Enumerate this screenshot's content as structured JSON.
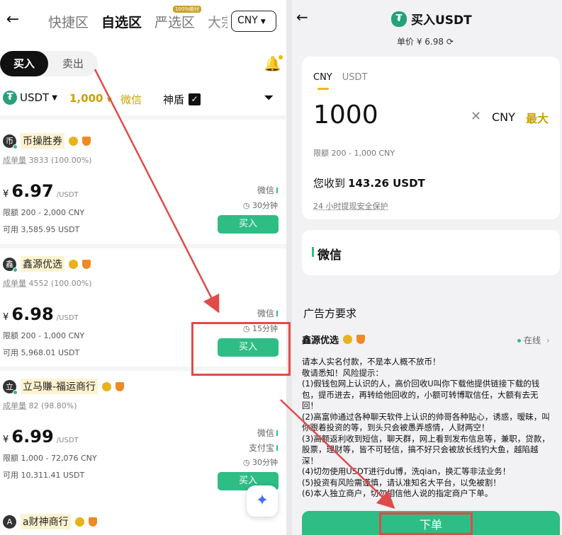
{
  "left": {
    "back_icon": "arrow-left-icon",
    "zone_tabs": [
      {
        "label": "快捷区",
        "active": false
      },
      {
        "label": "自选区",
        "active": true
      },
      {
        "label": "严选区",
        "active": false,
        "badge": "100%赔付"
      },
      {
        "label": "大宗",
        "active": false
      }
    ],
    "currency": "CNY",
    "buy_label": "买入",
    "sell_label": "卖出",
    "filters": {
      "asset": "USDT",
      "amount": "1,000",
      "payment": "微信",
      "shendun": "神盾",
      "shendun_checked": "✓"
    },
    "merchants": [
      {
        "avatar": "币",
        "name": "币操胜券",
        "trades_label": "成单量",
        "trades": "3833 (100.00%)",
        "currency_symbol": "¥",
        "price": "6.97",
        "unit": "/USDT",
        "limit_label": "限额",
        "limit": "200 - 2,000 CNY",
        "avail_label": "可用",
        "available": "3,585.95 USDT",
        "payments": [
          "微信"
        ],
        "time": "30分钟",
        "buy_label": "买入"
      },
      {
        "avatar": "鑫",
        "name": "鑫源优选",
        "trades_label": "成单量",
        "trades": "4552 (100.00%)",
        "currency_symbol": "¥",
        "price": "6.98",
        "unit": "/USDT",
        "limit_label": "限额",
        "limit": "200 - 1,000 CNY",
        "avail_label": "可用",
        "available": "5,968.01 USDT",
        "payments": [
          "微信"
        ],
        "time": "15分钟",
        "buy_label": "买入"
      },
      {
        "avatar": "立",
        "name": "立马賺-福运商行",
        "trades_label": "成单量",
        "trades": "82 (98.80%)",
        "currency_symbol": "¥",
        "price": "6.99",
        "unit": "/USDT",
        "limit_label": "限额",
        "limit": "1,000 - 72,076 CNY",
        "avail_label": "可用",
        "available": "10,311.41 USDT",
        "payments": [
          "微信",
          "支付宝"
        ],
        "time": "30分钟",
        "buy_label": "买入"
      },
      {
        "avatar": "A",
        "name": "a财神商行"
      }
    ]
  },
  "right": {
    "title": "买入USDT",
    "price_label": "单价",
    "price": "¥ 6.98",
    "tabs": [
      "CNY",
      "USDT"
    ],
    "amount": "1000",
    "amount_currency": "CNY",
    "max_label": "最大",
    "limit_label": "限额",
    "limit": "200 - 1,000 CNY",
    "receive_label": "您收到",
    "receive_amount": "143.26 USDT",
    "protection": "24 小时提现安全保护",
    "payment_method": "微信",
    "requirements_title": "广告方要求",
    "merchant_name": "鑫源优选",
    "status": "在线",
    "requirements_text": [
      "请本人实名付款，不是本人概不放币！",
      "敬请悉知！风险提示：",
      "(1)假钱包网上认识的人，高价回收U叫你下载他提供链接下载的钱包，提币进去，再转给他回收的，小额可转博取信任，大额有去无回！",
      "(2)高富帅通过各种聊天软件上认识的帅哥各种贴心，诱惑，暧昧，叫你跟着投资的等，到头只会被愚弄感情，人财两空！",
      "(3)高额返利收到短信，聊天群，网上看到发布信息等，兼职，贷款，股票，理财等，皆不可轻信，搞不好只会被放长线钓大鱼，越陷越深！",
      "(4)切勿使用USDT进行du博，洗qian，换汇等非法业务！",
      "(5)投资有风险需谨慎，请认准知名大平台，以免被割！",
      "(6)本人独立商户，切勿相信他人说的指定商户下单。"
    ],
    "order_label": "下单"
  },
  "colors": {
    "accent_green": "#2ebd85",
    "accent_gold": "#f0b90b",
    "annotation_red": "#e14a4a"
  }
}
